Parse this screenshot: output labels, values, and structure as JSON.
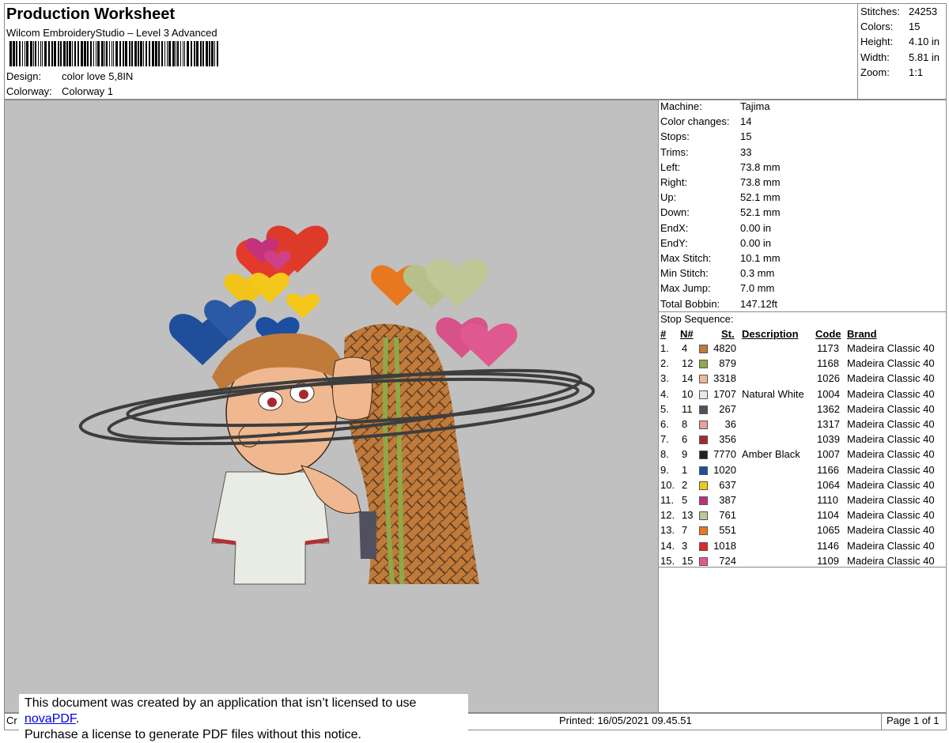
{
  "header": {
    "title": "Production Worksheet",
    "subtitle": "Wilcom EmbroideryStudio – Level 3 Advanced",
    "barcode_text": "color love 5,8IN",
    "design_label": "Design:",
    "design_value": "color love 5,8IN",
    "colorway_label": "Colorway:",
    "colorway_value": "Colorway 1"
  },
  "summary": [
    {
      "label": "Stitches:",
      "value": "24253"
    },
    {
      "label": "Colors:",
      "value": "15"
    },
    {
      "label": "Height:",
      "value": "4.10 in"
    },
    {
      "label": "Width:",
      "value": "5.81 in"
    },
    {
      "label": "Zoom:",
      "value": "1:1"
    }
  ],
  "machine_info": [
    {
      "label": "Machine:",
      "value": "Tajima"
    },
    {
      "label": "Color changes:",
      "value": "14"
    },
    {
      "label": "Stops:",
      "value": "15"
    },
    {
      "label": "Trims:",
      "value": "33"
    },
    {
      "label": "Left:",
      "value": "73.8 mm"
    },
    {
      "label": "Right:",
      "value": "73.8 mm"
    },
    {
      "label": "Up:",
      "value": "52.1 mm"
    },
    {
      "label": "Down:",
      "value": "52.1 mm"
    },
    {
      "label": "EndX:",
      "value": "0.00 in"
    },
    {
      "label": "EndY:",
      "value": "0.00 in"
    },
    {
      "label": "Max Stitch:",
      "value": "10.1 mm"
    },
    {
      "label": "Min Stitch:",
      "value": "0.3 mm"
    },
    {
      "label": "Max Jump:",
      "value": "7.0 mm"
    },
    {
      "label": "Total Bobbin:",
      "value": "147.12ft"
    }
  ],
  "stop_sequence": {
    "title": "Stop Sequence:",
    "headers": {
      "stop": "#",
      "n": "N#",
      "st": "St.",
      "description": "Description",
      "code": "Code",
      "brand": "Brand"
    },
    "rows": [
      {
        "stop": "1.",
        "n": "4",
        "color": "#c07a3a",
        "st": "4820",
        "description": "",
        "code": "1173",
        "brand": "Madeira Classic 40"
      },
      {
        "stop": "2.",
        "n": "12",
        "color": "#8fa848",
        "st": "879",
        "description": "",
        "code": "1168",
        "brand": "Madeira Classic 40"
      },
      {
        "stop": "3.",
        "n": "14",
        "color": "#f0b890",
        "st": "3318",
        "description": "",
        "code": "1026",
        "brand": "Madeira Classic 40"
      },
      {
        "stop": "4.",
        "n": "10",
        "color": "#e8e8ec",
        "st": "1707",
        "description": "Natural White",
        "code": "1004",
        "brand": "Madeira Classic 40"
      },
      {
        "stop": "5.",
        "n": "11",
        "color": "#50505e",
        "st": "267",
        "description": "",
        "code": "1362",
        "brand": "Madeira Classic 40"
      },
      {
        "stop": "6.",
        "n": "8",
        "color": "#e8a0a0",
        "st": "36",
        "description": "",
        "code": "1317",
        "brand": "Madeira Classic 40"
      },
      {
        "stop": "7.",
        "n": "6",
        "color": "#a82830",
        "st": "356",
        "description": "",
        "code": "1039",
        "brand": "Madeira Classic 40"
      },
      {
        "stop": "8.",
        "n": "9",
        "color": "#202020",
        "st": "7770",
        "description": "Amber Black",
        "code": "1007",
        "brand": "Madeira Classic 40"
      },
      {
        "stop": "9.",
        "n": "1",
        "color": "#1c4fa0",
        "st": "1020",
        "description": "",
        "code": "1166",
        "brand": "Madeira Classic 40"
      },
      {
        "stop": "10.",
        "n": "2",
        "color": "#f4c81a",
        "st": "637",
        "description": "",
        "code": "1064",
        "brand": "Madeira Classic 40"
      },
      {
        "stop": "11.",
        "n": "5",
        "color": "#c0307a",
        "st": "387",
        "description": "",
        "code": "1110",
        "brand": "Madeira Classic 40"
      },
      {
        "stop": "12.",
        "n": "13",
        "color": "#c0c898",
        "st": "761",
        "description": "",
        "code": "1104",
        "brand": "Madeira Classic 40"
      },
      {
        "stop": "13.",
        "n": "7",
        "color": "#e87820",
        "st": "551",
        "description": "",
        "code": "1065",
        "brand": "Madeira Classic 40"
      },
      {
        "stop": "14.",
        "n": "3",
        "color": "#e02828",
        "st": "1018",
        "description": "",
        "code": "1146",
        "brand": "Madeira Classic 40"
      },
      {
        "stop": "15.",
        "n": "15",
        "color": "#e05890",
        "st": "724",
        "description": "",
        "code": "1109",
        "brand": "Madeira Classic 40"
      }
    ]
  },
  "footer": {
    "left_text": "Cr",
    "printed": "Printed: 16/05/2021 09.45.51",
    "page": "Page 1 of 1"
  },
  "notice": {
    "line1_prefix": "This document was created by an application that isn’t licensed to use ",
    "link_text": "novaPDF",
    "line1_suffix": ".",
    "line2": "Purchase a license to generate PDF files without this notice."
  }
}
